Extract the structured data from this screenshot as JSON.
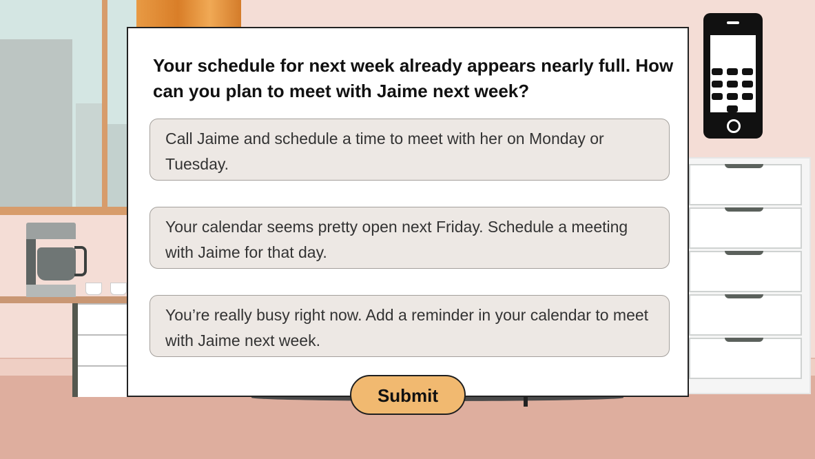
{
  "question": {
    "text": "Your schedule for next week already appears nearly full. How can you plan to meet with Jaime next week?"
  },
  "options": [
    {
      "text": "Call Jaime and schedule a time to meet with her on Monday or Tuesday."
    },
    {
      "text": "Your calendar seems pretty open next Friday. Schedule a meeting with Jaime for that day."
    },
    {
      "text": "You’re really busy right now. Add a reminder in your calendar to meet with Jaime next week."
    }
  ],
  "submit": {
    "label": "Submit"
  },
  "colors": {
    "option_bg": "#ede8e4",
    "submit_bg": "#f1b970",
    "wall": "#f4ddd6",
    "floor": "#deae9e"
  },
  "icons": {
    "phone": "smartphone-icon"
  }
}
